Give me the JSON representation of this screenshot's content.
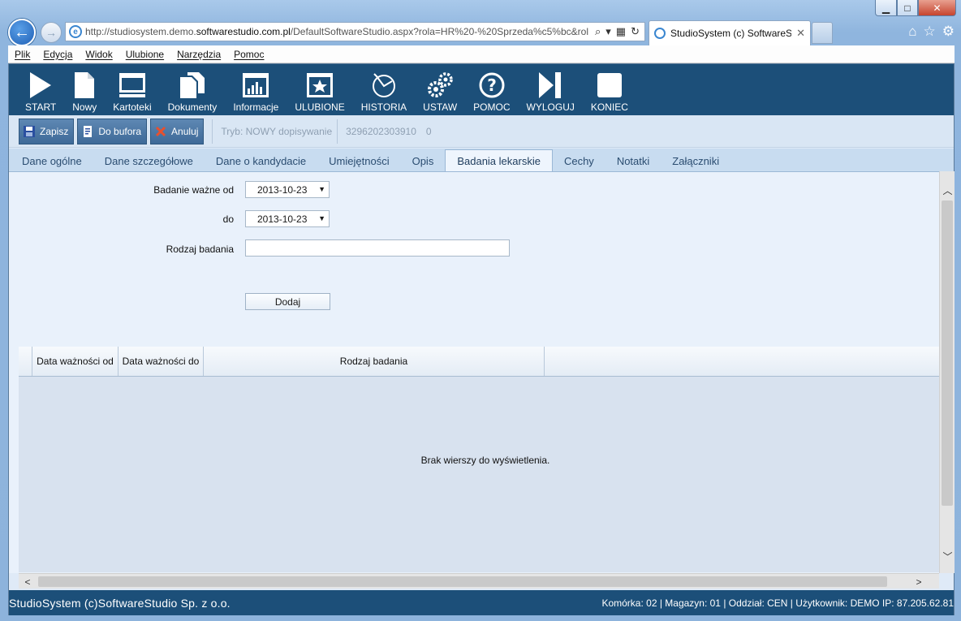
{
  "browser": {
    "url_prefix": "http://studiosystem.demo.",
    "url_domain": "softwarestudio.com.pl",
    "url_path": "/DefaultSoftwareStudio.aspx?rola=HR%20-%20Sprzeda%c5%bc&rol",
    "tab_title": "StudioSystem (c) SoftwareS...",
    "tab_close": "✕"
  },
  "menu": {
    "items": [
      "Plik",
      "Edycja",
      "Widok",
      "Ulubione",
      "Narzędzia",
      "Pomoc"
    ]
  },
  "toolbar": {
    "items": [
      {
        "label": "START",
        "icon": "play-icon"
      },
      {
        "label": "Nowy",
        "icon": "document-icon"
      },
      {
        "label": "Kartoteki",
        "icon": "card-file-icon"
      },
      {
        "label": "Dokumenty",
        "icon": "documents-icon"
      },
      {
        "label": "Informacje",
        "icon": "chart-icon"
      },
      {
        "label": "ULUBIONE",
        "icon": "star-icon"
      },
      {
        "label": "HISTORIA",
        "icon": "history-icon"
      },
      {
        "label": "USTAW",
        "icon": "gears-icon"
      },
      {
        "label": "POMOC",
        "icon": "help-icon"
      },
      {
        "label": "WYLOGUJ",
        "icon": "logout-icon"
      },
      {
        "label": "KONIEC",
        "icon": "stop-icon"
      }
    ]
  },
  "actions": {
    "save": "Zapisz",
    "to_buffer": "Do bufora",
    "cancel": "Anuluj",
    "mode": "Tryb: NOWY dopisywanie",
    "record_id": "3296202303910",
    "record_num": "0"
  },
  "tabs": {
    "items": [
      "Dane ogólne",
      "Dane szczegółowe",
      "Dane o kandydacie",
      "Umiejętności",
      "Opis",
      "Badania lekarskie",
      "Cechy",
      "Notatki",
      "Załączniki"
    ],
    "active_index": 5
  },
  "form": {
    "valid_from_label": "Badanie ważne od",
    "valid_from_value": "2013-10-23",
    "valid_to_label": "do",
    "valid_to_value": "2013-10-23",
    "exam_type_label": "Rodzaj badania",
    "exam_type_value": "",
    "add_button": "Dodaj"
  },
  "grid": {
    "col_from": "Data ważności od",
    "col_to": "Data ważności do",
    "col_type": "Rodzaj badania",
    "empty_message": "Brak wierszy do wyświetlenia."
  },
  "status": {
    "left": "StudioSystem (c)SoftwareStudio Sp. z o.o.",
    "right": "Komórka: 02 | Magazyn: 01 | Oddział: CEN | Użytkownik: DEMO IP: 87.205.62.81"
  }
}
